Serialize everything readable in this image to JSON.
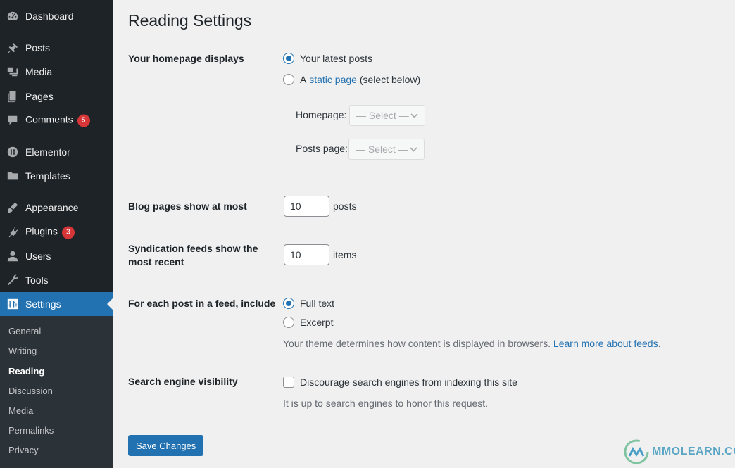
{
  "sidebar": {
    "items": [
      {
        "label": "Dashboard",
        "icon": "dashboard-icon"
      },
      {
        "label": "Posts",
        "icon": "pin-icon"
      },
      {
        "label": "Media",
        "icon": "media-icon"
      },
      {
        "label": "Pages",
        "icon": "pages-icon"
      },
      {
        "label": "Comments",
        "icon": "comment-icon",
        "badge": "5"
      },
      {
        "label": "Elementor",
        "icon": "elementor-icon"
      },
      {
        "label": "Templates",
        "icon": "folder-icon"
      },
      {
        "label": "Appearance",
        "icon": "brush-icon"
      },
      {
        "label": "Plugins",
        "icon": "plug-icon",
        "badge": "3"
      },
      {
        "label": "Users",
        "icon": "user-icon"
      },
      {
        "label": "Tools",
        "icon": "wrench-icon"
      },
      {
        "label": "Settings",
        "icon": "settings-icon",
        "current": true
      }
    ],
    "submenu": [
      "General",
      "Writing",
      "Reading",
      "Discussion",
      "Media",
      "Permalinks",
      "Privacy"
    ],
    "submenu_active": "Reading"
  },
  "page": {
    "title": "Reading Settings",
    "homepage_displays": {
      "label": "Your homepage displays",
      "option_latest": "Your latest posts",
      "option_static_prefix": "A",
      "option_static_link": "static page",
      "option_static_suffix": "(select below)",
      "selected": "latest",
      "homepage_label": "Homepage:",
      "homepage_select": "— Select —",
      "postspage_label": "Posts page:",
      "postspage_select": "— Select —"
    },
    "blog_pages": {
      "label": "Blog pages show at most",
      "value": "10",
      "unit": "posts"
    },
    "syndication": {
      "label": "Syndication feeds show the most recent",
      "value": "10",
      "unit": "items"
    },
    "feed_content": {
      "label": "For each post in a feed, include",
      "option_full": "Full text",
      "option_excerpt": "Excerpt",
      "selected": "full",
      "description": "Your theme determines how content is displayed in browsers.",
      "description_link": "Learn more about feeds",
      "description_end": "."
    },
    "search_visibility": {
      "label": "Search engine visibility",
      "checkbox_label": "Discourage search engines from indexing this site",
      "checked": false,
      "description": "It is up to search engines to honor this request."
    },
    "save_button": "Save Changes"
  },
  "watermark": {
    "text": "MMOLEARN.COM"
  },
  "colors": {
    "admin_blue": "#2271b1",
    "sidebar_bg": "#1d2327",
    "submenu_bg": "#2c3338",
    "badge_red": "#d63638"
  }
}
